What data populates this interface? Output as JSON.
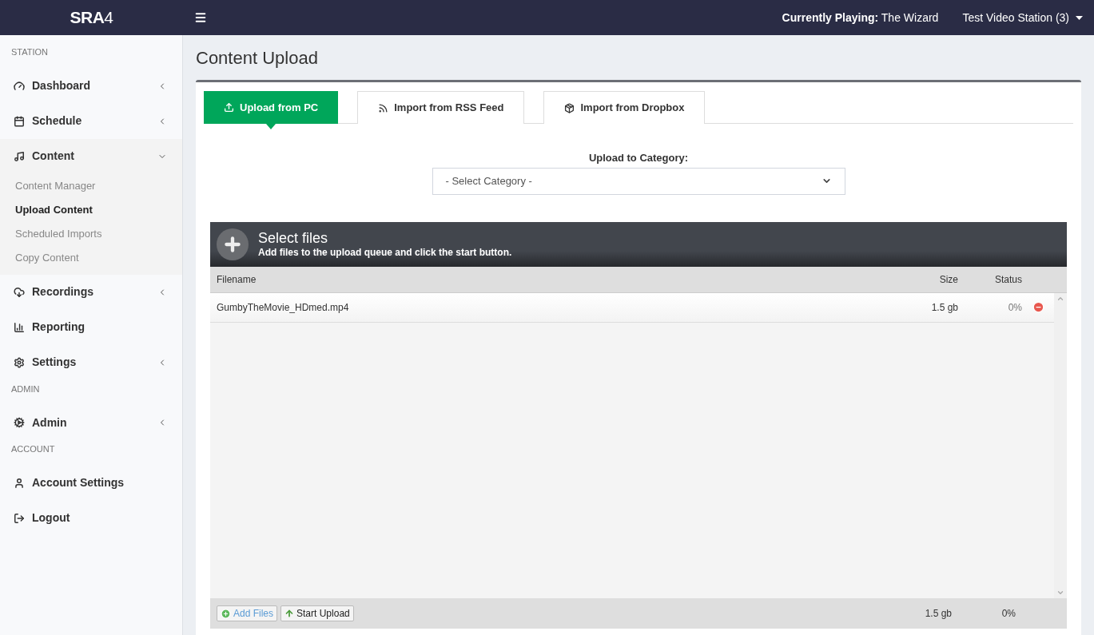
{
  "brand": {
    "name": "SRA",
    "suffix": "4"
  },
  "topbar": {
    "now_playing_label": "Currently Playing:",
    "now_playing_value": "The Wizard",
    "station": "Test Video Station (3)"
  },
  "sidebar": [
    {
      "kind": "section",
      "label": "STATION"
    },
    {
      "kind": "menu",
      "label": "Dashboard",
      "expanded": false
    },
    {
      "kind": "menu",
      "label": "Schedule",
      "expanded": false
    },
    {
      "kind": "menu",
      "label": "Content",
      "expanded": true,
      "children": [
        {
          "label": "Content Manager",
          "selected": false
        },
        {
          "label": "Upload Content",
          "selected": true
        },
        {
          "label": "Scheduled Imports",
          "selected": false
        },
        {
          "label": "Copy Content",
          "selected": false
        }
      ]
    },
    {
      "kind": "menu",
      "label": "Recordings",
      "expanded": false
    },
    {
      "kind": "link",
      "label": "Reporting"
    },
    {
      "kind": "menu",
      "label": "Settings",
      "expanded": false
    },
    {
      "kind": "section",
      "label": "ADMIN"
    },
    {
      "kind": "menu",
      "label": "Admin",
      "expanded": false
    },
    {
      "kind": "section",
      "label": "ACCOUNT"
    },
    {
      "kind": "link",
      "label": "Account Settings"
    },
    {
      "kind": "link",
      "label": "Logout"
    }
  ],
  "page_title": "Content Upload",
  "tabs": [
    {
      "label": "Upload from PC",
      "selected": true
    },
    {
      "label": "Import from RSS Feed",
      "selected": false
    },
    {
      "label": "Import from Dropbox",
      "selected": false
    }
  ],
  "category": {
    "label": "Upload to Category:",
    "value": "- Select Category -"
  },
  "uploader": {
    "title": "Select files",
    "subtitle": "Add files to the upload queue and click the start button.",
    "columns": [
      "Filename",
      "Size",
      "Status"
    ],
    "files": [
      {
        "name": "GumbyTheMovie_HDmed.mp4",
        "size": "1.5 gb",
        "status": "0%"
      }
    ],
    "buttons": [
      {
        "kind": "add",
        "label": "Add Files"
      },
      {
        "kind": "start",
        "label": "Start Upload"
      }
    ],
    "total_size": "1.5 gb",
    "total_status": "0%"
  }
}
